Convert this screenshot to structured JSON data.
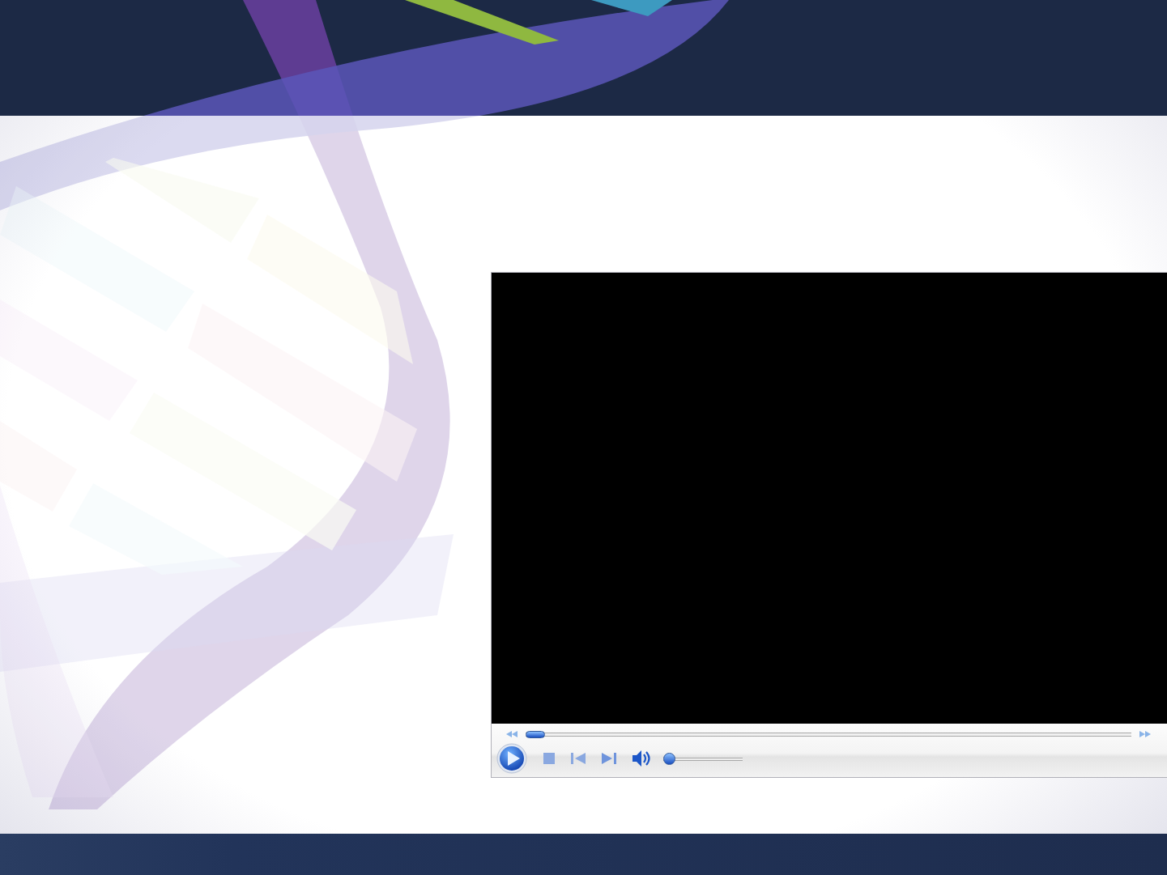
{
  "slide": {
    "video_player": {
      "playing": false,
      "seek": {
        "level": 0.0
      },
      "volume": {
        "level": 0.0
      }
    }
  }
}
